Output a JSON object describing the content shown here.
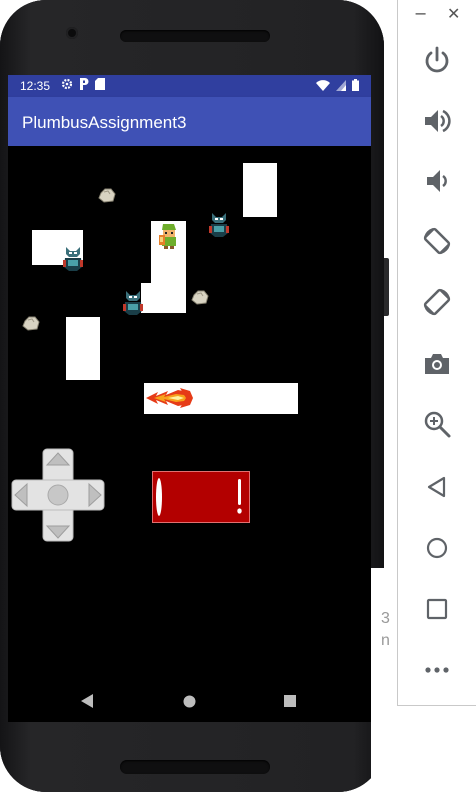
{
  "status_bar": {
    "time": "12:35"
  },
  "app_bar": {
    "title": "PlumbusAssignment3"
  },
  "background_window": {
    "text_line1": "3",
    "text_line2": "n"
  },
  "emulator_toolbar": {
    "items": [
      "power",
      "volume-up",
      "volume-down",
      "rotate-left",
      "rotate-right",
      "screenshot",
      "zoom",
      "back",
      "home",
      "overview",
      "more"
    ]
  },
  "game": {
    "walls": 5,
    "enemies": 3,
    "rocks": 3,
    "player": "link",
    "projectile": "fireball"
  },
  "colors": {
    "status_bar": "#303f9f",
    "app_bar": "#3f51b5",
    "game_bg": "#000000",
    "action_button": "#b30000"
  }
}
